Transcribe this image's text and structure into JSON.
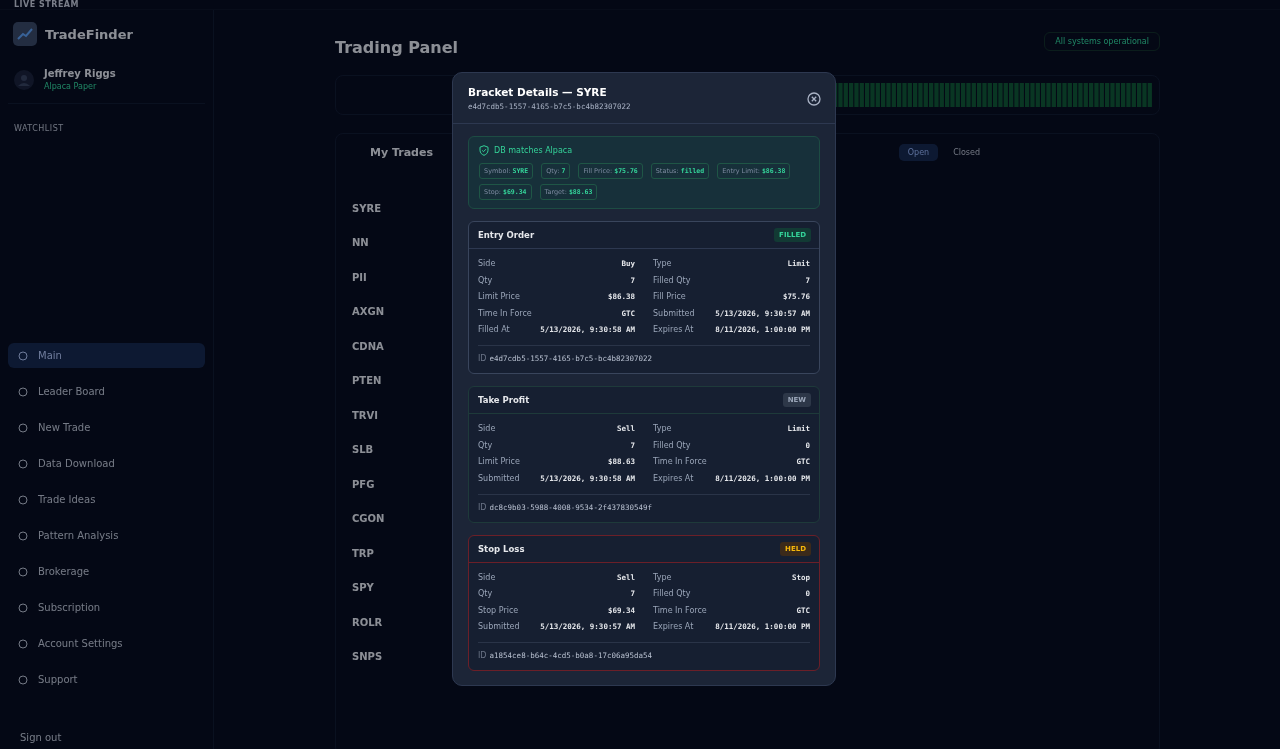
{
  "top_bar": {
    "label": "LIVE STREAM"
  },
  "sidebar": {
    "brand": "TradeFinder",
    "user": {
      "name": "Jeffrey Riggs",
      "account": "Alpaca Paper"
    },
    "watchlist_title": "WATCHLIST",
    "items": [
      {
        "label": "Main",
        "selected": true
      },
      {
        "label": "Leader Board",
        "selected": false
      },
      {
        "label": "New Trade",
        "selected": false
      },
      {
        "label": "Data Download",
        "selected": false
      },
      {
        "label": "Trade Ideas",
        "selected": false
      },
      {
        "label": "Pattern Analysis",
        "selected": false
      },
      {
        "label": "Brokerage",
        "selected": false
      },
      {
        "label": "Subscription",
        "selected": false
      },
      {
        "label": "Account Settings",
        "selected": false
      },
      {
        "label": "Support",
        "selected": false
      }
    ],
    "sign_out": "Sign out"
  },
  "page": {
    "title": "Trading Panel",
    "status": "All systems operational",
    "trades_title": "My Trades",
    "tabs": [
      {
        "label": "Open",
        "selected": true
      },
      {
        "label": "Closed",
        "selected": false
      }
    ],
    "symbols": [
      "SYRE",
      "NN",
      "PII",
      "AXGN",
      "CDNA",
      "PTEN",
      "TRVI",
      "SLB",
      "PFG",
      "CGON",
      "TRP",
      "SPY",
      "ROLR",
      "SNPS"
    ]
  },
  "modal": {
    "title": "Bracket Details — SYRE",
    "id": "e4d7cdb5-1557-4165-b7c5-bc4b82307022",
    "match": {
      "title": "DB matches Alpaca",
      "chips": [
        {
          "label": "Symbol:",
          "value": "SYRE"
        },
        {
          "label": "Qty:",
          "value": "7"
        },
        {
          "label": "Fill Price:",
          "value": "$75.76"
        },
        {
          "label": "Status:",
          "value": "filled"
        },
        {
          "label": "Entry Limit:",
          "value": "$86.38"
        },
        {
          "label": "Stop:",
          "value": "$69.34"
        },
        {
          "label": "Target:",
          "value": "$88.63"
        }
      ]
    },
    "orders": [
      {
        "name": "Entry Order",
        "kind": "filled",
        "badge": "FILLED",
        "fields": [
          {
            "label": "Side",
            "value": "Buy"
          },
          {
            "label": "Type",
            "value": "Limit"
          },
          {
            "label": "Qty",
            "value": "7"
          },
          {
            "label": "Filled Qty",
            "value": "7"
          },
          {
            "label": "Limit Price",
            "value": "$86.38"
          },
          {
            "label": "Fill Price",
            "value": "$75.76"
          },
          {
            "label": "Time In Force",
            "value": "GTC"
          },
          {
            "label": "Submitted",
            "value": "5/13/2026, 9:30:57 AM"
          },
          {
            "label": "Filled At",
            "value": "5/13/2026, 9:30:58 AM"
          },
          {
            "label": "Expires At",
            "value": "8/11/2026, 1:00:00 PM"
          }
        ],
        "id_label": "ID",
        "id": "e4d7cdb5-1557-4165-b7c5-bc4b82307022"
      },
      {
        "name": "Take Profit",
        "kind": "new",
        "badge": "NEW",
        "fields": [
          {
            "label": "Side",
            "value": "Sell"
          },
          {
            "label": "Type",
            "value": "Limit"
          },
          {
            "label": "Qty",
            "value": "7"
          },
          {
            "label": "Filled Qty",
            "value": "0"
          },
          {
            "label": "Limit Price",
            "value": "$88.63"
          },
          {
            "label": "Time In Force",
            "value": "GTC"
          },
          {
            "label": "Submitted",
            "value": "5/13/2026, 9:30:58 AM"
          },
          {
            "label": "Expires At",
            "value": "8/11/2026, 1:00:00 PM"
          }
        ],
        "id_label": "ID",
        "id": "dc8c9b03-5988-4008-9534-2f437830549f"
      },
      {
        "name": "Stop Loss",
        "kind": "held",
        "badge": "HELD",
        "fields": [
          {
            "label": "Side",
            "value": "Sell"
          },
          {
            "label": "Type",
            "value": "Stop"
          },
          {
            "label": "Qty",
            "value": "7"
          },
          {
            "label": "Filled Qty",
            "value": "0"
          },
          {
            "label": "Stop Price",
            "value": "$69.34"
          },
          {
            "label": "Time In Force",
            "value": "GTC"
          },
          {
            "label": "Submitted",
            "value": "5/13/2026, 9:30:57 AM"
          },
          {
            "label": "Expires At",
            "value": "8/11/2026, 1:00:00 PM"
          }
        ],
        "id_label": "ID",
        "id": "a1854ce8-b64c-4cd5-b0a8-17c06a95da54"
      }
    ]
  }
}
